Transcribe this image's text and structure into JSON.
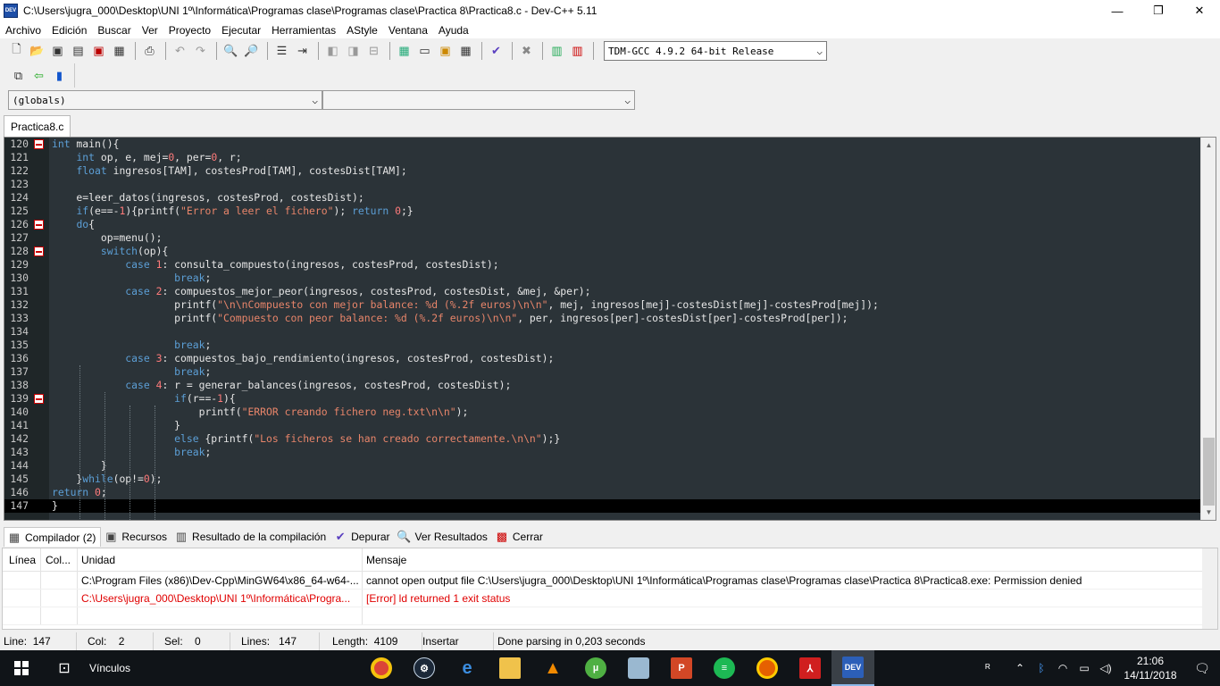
{
  "window": {
    "title": "C:\\Users\\jugra_000\\Desktop\\UNI 1º\\Informática\\Programas clase\\Programas clase\\Practica 8\\Practica8.c - Dev-C++ 5.11",
    "app_icon_text": "DEV"
  },
  "menu": [
    "Archivo",
    "Edición",
    "Buscar",
    "Ver",
    "Proyecto",
    "Ejecutar",
    "Herramientas",
    "AStyle",
    "Ventana",
    "Ayuda"
  ],
  "toolbar": {
    "compiler": "TDM-GCC 4.9.2 64-bit Release",
    "scope_combo": "(globals)",
    "function_combo": ""
  },
  "tabs": [
    "Practica8.c"
  ],
  "editor": {
    "colors": {
      "background": "#2b3338",
      "keyword": "#5c9fd6",
      "number": "#ff7b7b",
      "string": "#e8856a",
      "default": "#e6e6e6"
    },
    "lines": [
      {
        "n": "120",
        "text": "int main(){"
      },
      {
        "n": "121",
        "text": "    int op, e, mej=0, per=0, r;"
      },
      {
        "n": "122",
        "text": "    float ingresos[TAM], costesProd[TAM], costesDist[TAM];"
      },
      {
        "n": "123",
        "text": ""
      },
      {
        "n": "124",
        "text": "    e=leer_datos(ingresos, costesProd, costesDist);"
      },
      {
        "n": "125",
        "text": "    if(e==-1){printf(\"Error a leer el fichero\"); return 0;}"
      },
      {
        "n": "126",
        "text": "    do{"
      },
      {
        "n": "127",
        "text": "        op=menu();"
      },
      {
        "n": "128",
        "text": "        switch(op){"
      },
      {
        "n": "129",
        "text": "            case 1: consulta_compuesto(ingresos, costesProd, costesDist);"
      },
      {
        "n": "130",
        "text": "                    break;"
      },
      {
        "n": "131",
        "text": "            case 2: compuestos_mejor_peor(ingresos, costesProd, costesDist, &mej, &per);"
      },
      {
        "n": "132",
        "text": "                    printf(\"\\n\\nCompuesto con mejor balance: %d (%.2f euros)\\n\\n\", mej, ingresos[mej]-costesDist[mej]-costesProd[mej]);"
      },
      {
        "n": "133",
        "text": "                    printf(\"Compuesto con peor balance: %d (%.2f euros)\\n\\n\", per, ingresos[per]-costesDist[per]-costesProd[per]);"
      },
      {
        "n": "134",
        "text": ""
      },
      {
        "n": "135",
        "text": "                    break;"
      },
      {
        "n": "136",
        "text": "            case 3: compuestos_bajo_rendimiento(ingresos, costesProd, costesDist);"
      },
      {
        "n": "137",
        "text": "                    break;"
      },
      {
        "n": "138",
        "text": "            case 4: r = generar_balances(ingresos, costesProd, costesDist);"
      },
      {
        "n": "139",
        "text": "                    if(r==-1){"
      },
      {
        "n": "140",
        "text": "                        printf(\"ERROR creando fichero neg.txt\\n\\n\");"
      },
      {
        "n": "141",
        "text": "                    }"
      },
      {
        "n": "142",
        "text": "                    else {printf(\"Los ficheros se han creado correctamente.\\n\\n\");}"
      },
      {
        "n": "143",
        "text": "                    break;"
      },
      {
        "n": "144",
        "text": "        }"
      },
      {
        "n": "145",
        "text": "    }while(op!=0);"
      },
      {
        "n": "146",
        "text": "return 0;"
      },
      {
        "n": "147",
        "text": "}"
      }
    ]
  },
  "bottom_tabs": [
    "Compilador (2)",
    "Recursos",
    "Resultado de la compilación",
    "Depurar",
    "Ver Resultados",
    "Cerrar"
  ],
  "messages": {
    "headers": [
      "Línea",
      "Col...",
      "Unidad",
      "Mensaje"
    ],
    "rows": [
      {
        "linea": "",
        "col": "",
        "unidad": "C:\\Program Files (x86)\\Dev-Cpp\\MinGW64\\x86_64-w64-...",
        "mensaje": "cannot open output file C:\\Users\\jugra_000\\Desktop\\UNI 1º\\Informática\\Programas clase\\Programas clase\\Practica 8\\Practica8.exe: Permission denied",
        "error": false
      },
      {
        "linea": "",
        "col": "",
        "unidad": "C:\\Users\\jugra_000\\Desktop\\UNI 1º\\Informática\\Progra...",
        "mensaje": "[Error] ld returned 1 exit status",
        "error": true
      }
    ]
  },
  "status": {
    "line_label": "Line:",
    "line_value": "147",
    "col_label": "Col:",
    "col_value": "2",
    "sel_label": "Sel:",
    "sel_value": "0",
    "lines_label": "Lines:",
    "lines_value": "147",
    "length_label": "Length:",
    "length_value": "4109",
    "mode": "Insertar",
    "parse_message": "Done parsing in 0,203 seconds"
  },
  "taskbar": {
    "links_label": "Vínculos",
    "apps": [
      "chrome-icon",
      "steam-icon",
      "edge-icon",
      "file-explorer-icon",
      "vlc-icon",
      "utorrent-icon",
      "cube-icon",
      "powerpoint-icon",
      "spotify-icon",
      "firefox-icon",
      "acrobat-icon",
      "devcpp-icon"
    ],
    "devcpp_label": "DEV",
    "time": "21:06",
    "date": "14/11/2018"
  }
}
